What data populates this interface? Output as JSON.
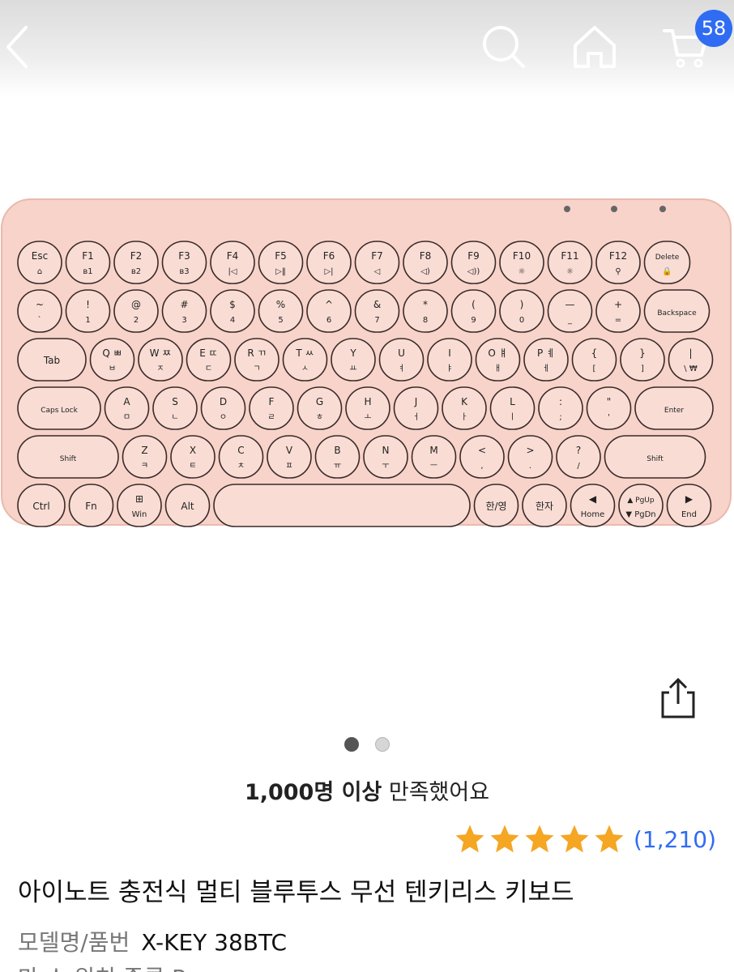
{
  "header": {
    "back_icon": "chevron-left-icon",
    "search_icon": "search-icon",
    "home_icon": "home-icon",
    "cart_icon": "cart-icon",
    "cart_count": "58"
  },
  "product_image": {
    "keyboard": {
      "rows": [
        [
          [
            "Esc",
            "⌂"
          ],
          [
            "F1",
            "ʙ1"
          ],
          [
            "F2",
            "ʙ2"
          ],
          [
            "F3",
            "ʙ3"
          ],
          [
            "F4",
            "|◁"
          ],
          [
            "F5",
            "▷‖"
          ],
          [
            "F6",
            "▷|"
          ],
          [
            "F7",
            "◁"
          ],
          [
            "F8",
            "◁)"
          ],
          [
            "F9",
            "◁))"
          ],
          [
            "F10",
            "☼"
          ],
          [
            "F11",
            "☼"
          ],
          [
            "F12",
            "⚲"
          ],
          [
            "Delete",
            "🔒"
          ]
        ],
        [
          [
            "~",
            "`"
          ],
          [
            "!",
            "1"
          ],
          [
            "@",
            "2"
          ],
          [
            "#",
            "3"
          ],
          [
            "$",
            "4"
          ],
          [
            "%",
            "5"
          ],
          [
            "^",
            "6"
          ],
          [
            "&",
            "7"
          ],
          [
            "*",
            "8"
          ],
          [
            "(",
            "9"
          ],
          [
            ")",
            "0"
          ],
          [
            "—",
            "_"
          ],
          [
            "+",
            "="
          ],
          [
            "Backspace",
            ""
          ]
        ],
        [
          [
            "Tab",
            ""
          ],
          [
            "Q ㅃ",
            "ㅂ"
          ],
          [
            "W ㅉ",
            "ㅈ"
          ],
          [
            "E ㄸ",
            "ㄷ"
          ],
          [
            "R ㄲ",
            "ㄱ"
          ],
          [
            "T ㅆ",
            "ㅅ"
          ],
          [
            "Y",
            "ㅛ"
          ],
          [
            "U",
            "ㅕ"
          ],
          [
            "I",
            "ㅑ"
          ],
          [
            "O ㅒ",
            "ㅐ"
          ],
          [
            "P ㅖ",
            "ㅔ"
          ],
          [
            "{",
            "["
          ],
          [
            "}",
            "]"
          ],
          [
            "|",
            "\\ ₩"
          ]
        ],
        [
          [
            "Caps Lock",
            ""
          ],
          [
            "A",
            "ㅁ"
          ],
          [
            "S",
            "ㄴ"
          ],
          [
            "D",
            "ㅇ"
          ],
          [
            "F",
            "ㄹ"
          ],
          [
            "G",
            "ㅎ"
          ],
          [
            "H",
            "ㅗ"
          ],
          [
            "J",
            "ㅓ"
          ],
          [
            "K",
            "ㅏ"
          ],
          [
            "L",
            "ㅣ"
          ],
          [
            ":",
            ";"
          ],
          [
            "\"",
            "'"
          ],
          [
            "Enter",
            ""
          ]
        ],
        [
          [
            "Shift",
            ""
          ],
          [
            "Z",
            "ㅋ"
          ],
          [
            "X",
            "ㅌ"
          ],
          [
            "C",
            "ㅊ"
          ],
          [
            "V",
            "ㅍ"
          ],
          [
            "B",
            "ㅠ"
          ],
          [
            "N",
            "ㅜ"
          ],
          [
            "M",
            "ㅡ"
          ],
          [
            "<",
            ","
          ],
          [
            ">",
            "."
          ],
          [
            "?",
            "/"
          ],
          [
            "Shift",
            ""
          ]
        ],
        [
          [
            "Ctrl",
            ""
          ],
          [
            "Fn",
            ""
          ],
          [
            "⊞",
            "Win"
          ],
          [
            "Alt",
            ""
          ],
          [
            "",
            ""
          ],
          [
            "한/영",
            ""
          ],
          [
            "한자",
            ""
          ],
          [
            "◀",
            "Home"
          ],
          [
            "▲ PgUp",
            "▼ PgDn"
          ],
          [
            "▶",
            "End"
          ]
        ]
      ]
    }
  },
  "share_icon": "share-icon",
  "carousel": {
    "total": 2,
    "active": 0
  },
  "satisfaction": {
    "bold": "1,000명 이상",
    "rest": " 만족했어요"
  },
  "rating": {
    "stars": 5,
    "star_color": "#f5a623",
    "count": "(1,210)"
  },
  "product": {
    "title": "아이노트 충전식 멀티 블루투스 무선 텐키리스 키보드",
    "model_label": "모델명/품번",
    "model_value": "X-KEY 38BTC",
    "partial_line": "마 스 위치 종류  R ..."
  },
  "colors": {
    "accent": "#2f6cf3",
    "keyboard_body": "#f7d3ca",
    "keycap": "#f9ddd5"
  }
}
